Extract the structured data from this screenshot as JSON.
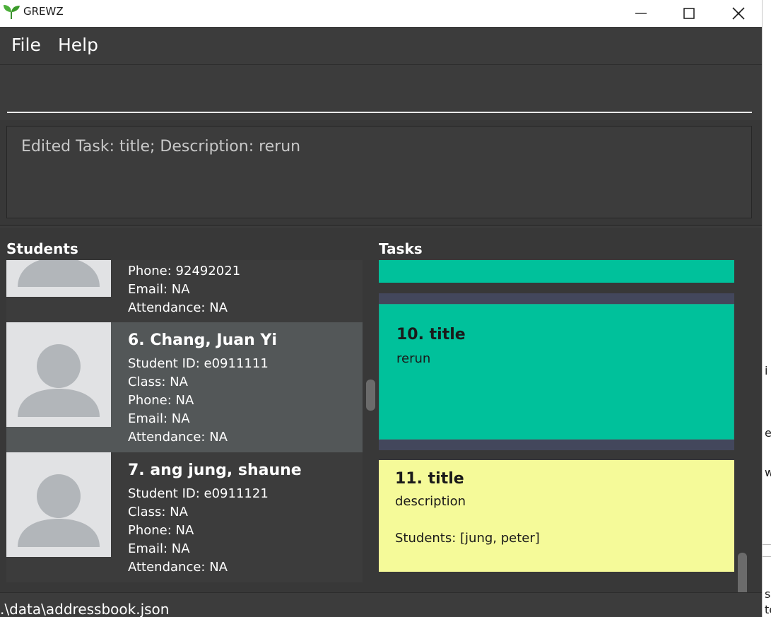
{
  "window": {
    "title": "GREWZ",
    "logo_icon": "sprout-icon",
    "controls": {
      "minimize_icon": "minimize-icon",
      "maximize_icon": "maximize-icon",
      "close_icon": "close-icon"
    }
  },
  "menu": {
    "file": "File",
    "help": "Help"
  },
  "command_box": {
    "value": "",
    "placeholder": ""
  },
  "result": {
    "message": "Edited Task: title; Description: rerun"
  },
  "students_panel": {
    "title": "Students",
    "partial_card": {
      "phone": "Phone: 92492021",
      "email": "Email: NA",
      "attendance": "Attendance: NA"
    },
    "cards": [
      {
        "name": "6.  Chang, Juan Yi",
        "student_id": "Student ID: e0911111",
        "class": "Class: NA",
        "phone": "Phone: NA",
        "email": "Email: NA",
        "attendance": "Attendance: NA"
      },
      {
        "name": "7.  ang jung, shaune",
        "student_id": "Student ID: e0911121",
        "class": "Class: NA",
        "phone": "Phone: NA",
        "email": "Email: NA",
        "attendance": "Attendance: NA"
      }
    ]
  },
  "tasks_panel": {
    "title": "Tasks",
    "cards": [
      {
        "title": "10.  title",
        "description": "rerun",
        "color": "#00c19b"
      },
      {
        "title": "11.  title",
        "description": "description",
        "students": "Students: [jung, peter]",
        "color": "#f5fa99"
      }
    ]
  },
  "status": {
    "path": ".\\data\\addressbook.json"
  },
  "colors": {
    "background": "#3c3c3c",
    "selected_card": "#535758",
    "task_done": "#00c19b",
    "task_pending": "#f5fa99",
    "task_separator": "#43475c"
  },
  "background_window_fragments": [
    "i",
    "e",
    "w",
    "s",
    "te"
  ]
}
